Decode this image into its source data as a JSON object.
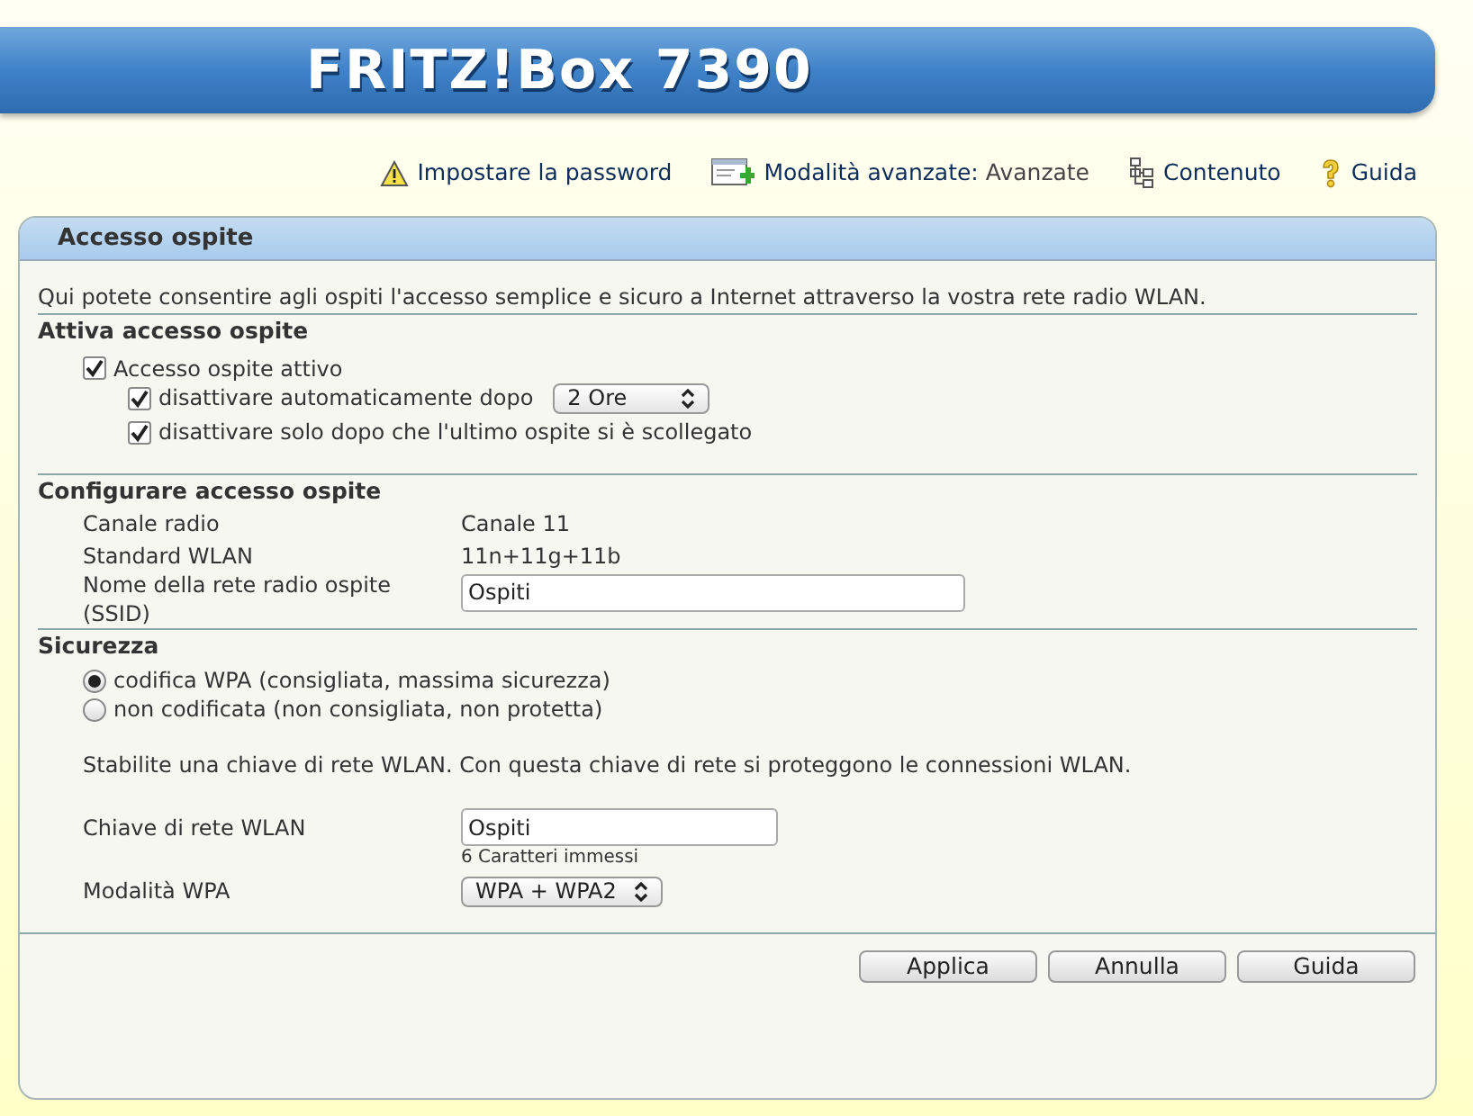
{
  "header": {
    "logo": "FRITZ!Box 7390"
  },
  "top_links": [
    {
      "kind": "warning",
      "label": "Impostare la password"
    },
    {
      "kind": "mode",
      "label": "Modalità avanzate:",
      "value": "Avanzate"
    },
    {
      "kind": "tree",
      "label": "Contenuto"
    },
    {
      "kind": "help",
      "label": "Guida"
    }
  ],
  "panel": {
    "title": "Accesso ospite",
    "intro": "Qui potete consentire agli ospiti l'accesso semplice e sicuro a Internet attraverso la vostra rete radio WLAN.",
    "activate": {
      "title": "Attiva accesso ospite",
      "main": {
        "label": "Accesso ospite attivo",
        "checked": true
      },
      "options": [
        {
          "label": "disattivare automaticamente dopo",
          "checked": true,
          "select": "2 Ore"
        },
        {
          "label": "disattivare solo dopo che l'ultimo ospite si è scollegato",
          "checked": true
        }
      ]
    },
    "configure": {
      "title": "Configurare accesso ospite",
      "rows": [
        {
          "kind": "text",
          "label": "Canale radio",
          "value": "Canale 11"
        },
        {
          "kind": "text",
          "label": "Standard WLAN",
          "value": "11n+11g+11b"
        },
        {
          "kind": "input",
          "label": "Nome della rete radio ospite (SSID)",
          "value": "Ospiti"
        }
      ]
    },
    "security": {
      "title": "Sicurezza",
      "options": [
        {
          "label": "codifica WPA (consigliata, massima sicurezza)",
          "selected": true
        },
        {
          "label": "non codificata (non consigliata, non protetta)",
          "selected": false
        }
      ],
      "note": "Stabilite una chiave di rete WLAN. Con questa chiave di rete si proteggono le connessioni WLAN.",
      "key": {
        "label": "Chiave di rete WLAN",
        "value": "Ospiti",
        "hint": "6 Caratteri immessi"
      },
      "mode": {
        "label": "Modalità WPA",
        "value": "WPA + WPA2"
      }
    },
    "buttons": [
      "Applica",
      "Annulla",
      "Guida"
    ]
  }
}
